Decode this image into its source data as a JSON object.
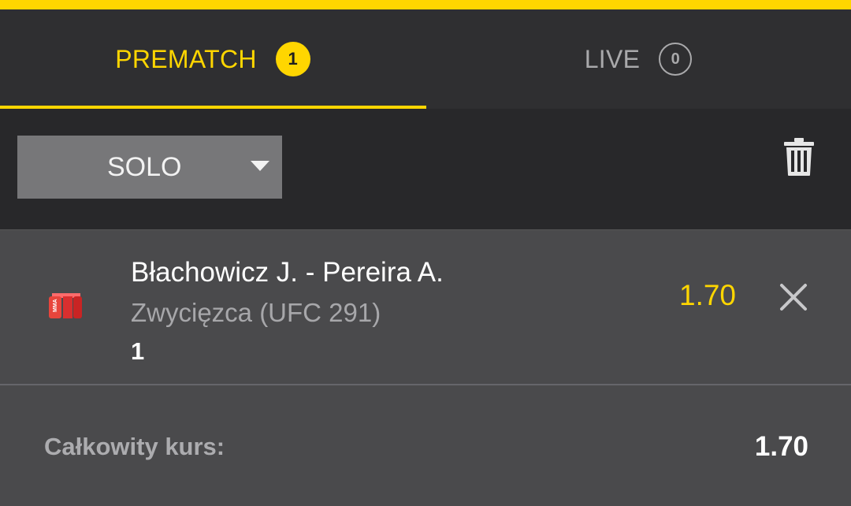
{
  "tabs": [
    {
      "label": "PREMATCH",
      "count": "1",
      "active": true
    },
    {
      "label": "LIVE",
      "count": "0",
      "active": false
    }
  ],
  "controls": {
    "bet_type": "SOLO",
    "delete_icon": "trash-icon",
    "dropdown_icon": "caret-down-icon"
  },
  "bet": {
    "sport_icon": "mma-icon",
    "title": "Błachowicz J. - Pereira A.",
    "market": "Zwycięzca (UFC 291)",
    "pick": "1",
    "odds": "1.70",
    "remove_icon": "close-icon"
  },
  "summary": {
    "label": "Całkowity kurs:",
    "value": "1.70"
  },
  "colors": {
    "accent": "#ffd600",
    "background": "#4a4a4c",
    "header": "#2f2f31"
  }
}
